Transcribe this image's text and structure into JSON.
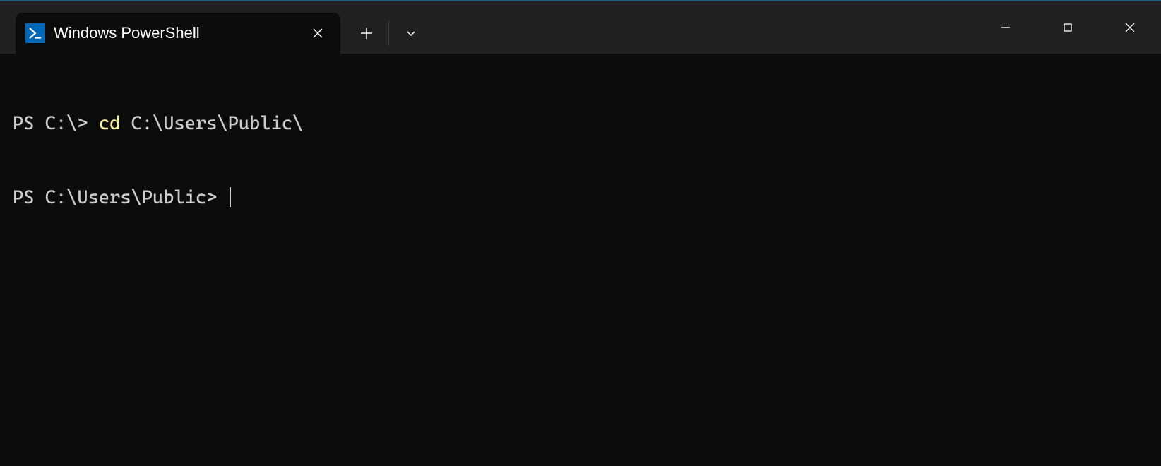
{
  "tab": {
    "title": "Windows PowerShell"
  },
  "terminal": {
    "lines": [
      {
        "prompt": "PS C:\\> ",
        "cmd": "cd",
        "arg": " C:\\Users\\Public\\"
      },
      {
        "prompt": "PS C:\\Users\\Public> ",
        "cmd": "",
        "arg": ""
      }
    ]
  }
}
